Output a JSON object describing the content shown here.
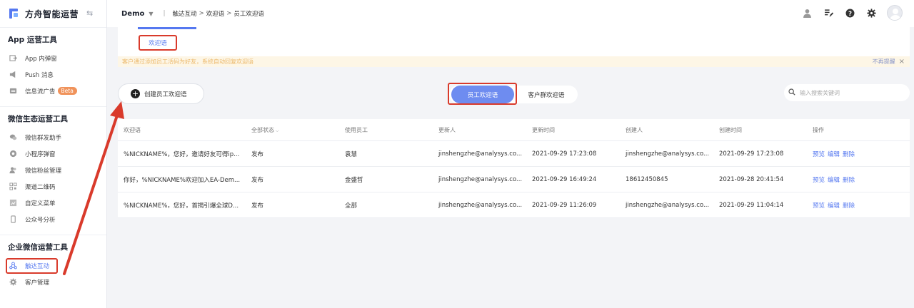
{
  "brand": {
    "name": "方舟智能运营"
  },
  "sidebar": {
    "groups": [
      {
        "title": "App 运营工具",
        "items": [
          {
            "label": "App 内弹窗"
          },
          {
            "label": "Push 消息"
          },
          {
            "label": "信息流广告",
            "badge": "Beta"
          }
        ]
      },
      {
        "title": "微信生态运营工具",
        "items": [
          {
            "label": "微信群发助手"
          },
          {
            "label": "小程序弹窗"
          },
          {
            "label": "微信粉丝管理"
          },
          {
            "label": "渠道二维码"
          },
          {
            "label": "自定义菜单"
          },
          {
            "label": "公众号分析"
          }
        ]
      },
      {
        "title": "企业微信运营工具",
        "items": [
          {
            "label": "触达互动",
            "active": true
          },
          {
            "label": "客户管理"
          }
        ]
      }
    ]
  },
  "header": {
    "project": "Demo",
    "separator": "|",
    "breadcrumb": [
      "触达互动",
      "欢迎语",
      "员工欢迎语"
    ],
    "crumb_sep": ">"
  },
  "tabs": {
    "welcome": "欢迎语"
  },
  "notice": {
    "text": "客户通过添加员工活码为好友，系统自动回复欢迎语",
    "dismiss": "不再提醒",
    "close": "×"
  },
  "toolbar": {
    "create_label": "创建员工欢迎语",
    "seg_active": "员工欢迎语",
    "seg_other": "客户群欢迎语",
    "search_placeholder": "输入搜索关键词"
  },
  "table": {
    "columns": [
      "欢迎语",
      "全部状态",
      "使用员工",
      "更新人",
      "更新时间",
      "创建人",
      "创建时间",
      "操作"
    ],
    "rows": [
      {
        "msg": "%NICKNAME%，您好，邀请好友可得ip...",
        "status": "发布",
        "staff": "袁慧",
        "updater": "jinshengzhe@analysys.co...",
        "updated": "2021-09-29 17:23:08",
        "creator": "jinshengzhe@analysys.co...",
        "created": "2021-09-29 17:23:08"
      },
      {
        "msg": "你好，%NICKNAME%欢迎加入EA-Dem...",
        "status": "发布",
        "staff": "金盛哲",
        "updater": "jinshengzhe@analysys.co...",
        "updated": "2021-09-29 16:49:24",
        "creator": "18612450845",
        "created": "2021-09-28 20:41:54"
      },
      {
        "msg": "%NICKNAME%，您好，首揭引爆全球D...",
        "status": "发布",
        "staff": "全部",
        "updater": "jinshengzhe@analysys.co...",
        "updated": "2021-09-29 11:26:09",
        "creator": "jinshengzhe@analysys.co...",
        "created": "2021-09-29 11:04:14"
      }
    ],
    "actions": [
      "预览",
      "编辑",
      "删除"
    ]
  },
  "colors": {
    "accent": "#5578f0",
    "highlight": "#d93a2b",
    "notice_bg": "#fdf6e6",
    "badge": "#f0935b"
  }
}
